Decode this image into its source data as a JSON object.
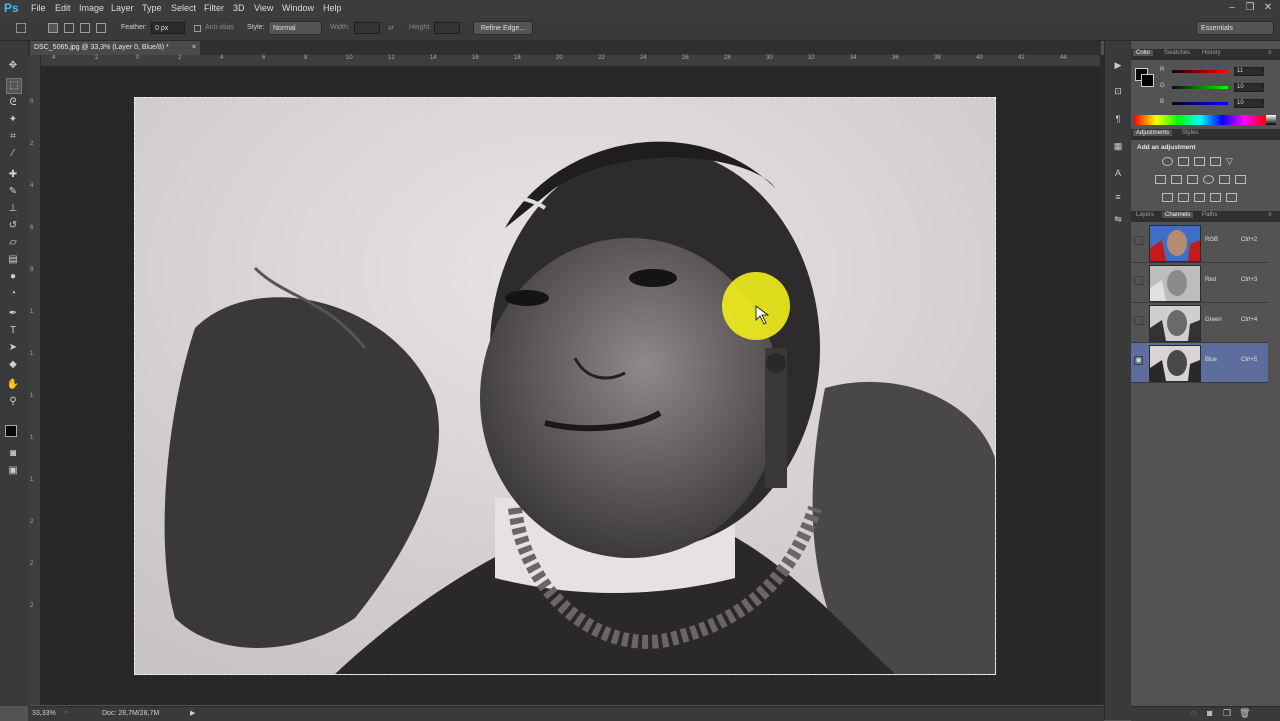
{
  "app": {
    "logo": "Ps"
  },
  "menu": [
    "File",
    "Edit",
    "Image",
    "Layer",
    "Type",
    "Select",
    "Filter",
    "3D",
    "View",
    "Window",
    "Help"
  ],
  "window_controls": [
    "–",
    "❐",
    "✕"
  ],
  "options": {
    "feather_label": "Feather:",
    "feather_value": "0 px",
    "antialias_label": "Anti-alias",
    "style_label": "Style:",
    "style_value": "Normal",
    "width_label": "Width:",
    "height_label": "Height:",
    "refine_edge": "Refine Edge...",
    "workspace": "Essentials"
  },
  "document": {
    "tab_title": "DSC_5065.jpg @ 33,3% (Layer 0, Blue/8) *",
    "close": "×"
  },
  "ruler_top": [
    "4",
    "2",
    "0",
    "2",
    "4",
    "6",
    "8",
    "10",
    "12",
    "14",
    "16",
    "18",
    "20",
    "22",
    "24",
    "26",
    "28",
    "30",
    "32",
    "34",
    "36",
    "38",
    "40",
    "42",
    "44"
  ],
  "ruler_left": [
    "0",
    "2",
    "4",
    "6",
    "8",
    "1",
    "1",
    "1",
    "1",
    "1",
    "2",
    "2",
    "2"
  ],
  "status": {
    "zoom": "33,33%",
    "doc": "Doc: 28,7M/28,7M"
  },
  "color_panel": {
    "tabs": [
      "Color",
      "Swatches",
      "History"
    ],
    "rows": [
      {
        "label": "R",
        "value": "11"
      },
      {
        "label": "G",
        "value": "10"
      },
      {
        "label": "B",
        "value": "10"
      }
    ]
  },
  "adjustments_panel": {
    "tabs": [
      "Adjustments",
      "Styles"
    ],
    "heading": "Add an adjustment"
  },
  "channels_panel": {
    "tabs": [
      "Layers",
      "Channels",
      "Paths"
    ],
    "channels": [
      {
        "name": "RGB",
        "shortcut": "Ctrl+2",
        "visible": false,
        "selected": false
      },
      {
        "name": "Red",
        "shortcut": "Ctrl+3",
        "visible": false,
        "selected": false
      },
      {
        "name": "Green",
        "shortcut": "Ctrl+4",
        "visible": false,
        "selected": false
      },
      {
        "name": "Blue",
        "shortcut": "Ctrl+5",
        "visible": true,
        "selected": true
      }
    ]
  },
  "colors": {
    "accent": "#5d6e9e",
    "cursor_highlight": "#f2ee1c",
    "ps_blue": "#49b5f0"
  }
}
